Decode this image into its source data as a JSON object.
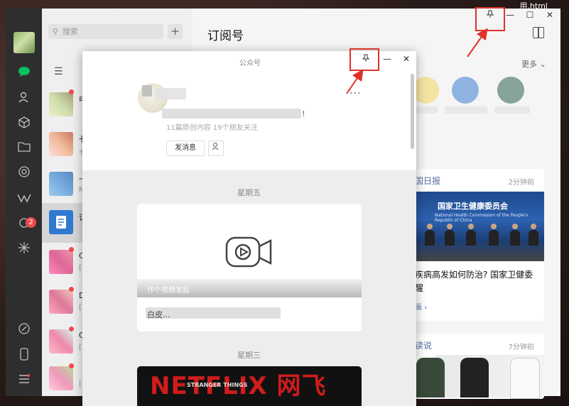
{
  "desktop": {
    "top_right_text": "用.html"
  },
  "search": {
    "placeholder": "搜索",
    "add_label": "+"
  },
  "chat_list": [
    {
      "name": "申",
      "sub": ""
    },
    {
      "name": "七",
      "sub": "七"
    },
    {
      "name": "一",
      "sub": "N"
    },
    {
      "name": "订",
      "sub": ""
    },
    {
      "name": "C",
      "sub": "["
    },
    {
      "name": "D",
      "sub": "["
    },
    {
      "name": "C",
      "sub": "["
    },
    {
      "name": "",
      "sub": "["
    }
  ],
  "nav_badge": "2",
  "main": {
    "title": "订阅号",
    "more_label": "更多",
    "win_min": "—",
    "win_max": "☐",
    "win_close": "✕",
    "pin": "📌"
  },
  "news_card": {
    "source": "国日报",
    "time": "2分钟前",
    "image_title": "国家卫生健康委员会",
    "image_subtitle": "National Health Commission of the People's Republic of China",
    "headline": "疾病高发如何防治? 国家卫健委 醒",
    "link": "画 ›"
  },
  "shop_card": {
    "source": "读说",
    "time": "7分钟前"
  },
  "popup": {
    "title": "公众号",
    "pin": "📌",
    "minimize": "—",
    "close": "✕",
    "profile_name": "",
    "profile_desc": "!",
    "profile_stats": "11篇原创内容  19个朋友关注",
    "more": "···",
    "send_message": "发消息",
    "day1": "星期五",
    "video_caption": "作个视频发起",
    "article_title": "白皮...",
    "day2": "星期三",
    "netflix_text": "NETFLIX 网飞",
    "stranger_text": "STRANGER THINGS"
  },
  "colors": {
    "annotation": "#e0322a",
    "badge": "#f04a4a",
    "link": "#5a6ea6"
  }
}
